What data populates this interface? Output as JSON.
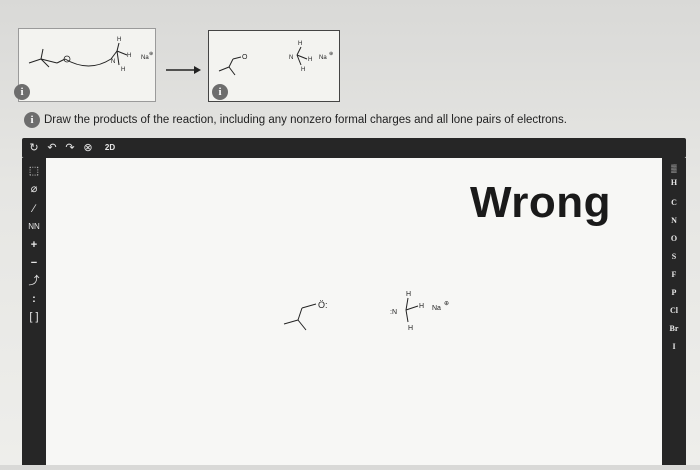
{
  "reaction": {
    "reactant_counterion": "Na",
    "reactant_counterion_charge": "⊕",
    "product_counterion": "Na",
    "product_counterion_charge": "⊕",
    "h_label": "H",
    "n_label": "N",
    "o_label": "O"
  },
  "info_icon_label": "i",
  "instructions": "Draw the products of the reaction, including any nonzero formal charges and all lone pairs of electrons.",
  "feedback": "Wrong",
  "toolbar": {
    "top_icons": [
      "clear-icon",
      "undo-icon",
      "redo-icon",
      "zoom-icon",
      "3d-template-icon"
    ],
    "template_label": "2D"
  },
  "left_tools": [
    "select-tool-icon",
    "eraser-tool-icon",
    "bond-tool-icon",
    "chain-tool-icon",
    "charge-plus-icon",
    "charge-minus-icon",
    "arrow-tool-icon",
    "lone-pair-icon",
    "bracket-tool-icon"
  ],
  "left_tool_labels": {
    "chain": "NN",
    "plus": "+",
    "minus": "−",
    "lone_pair": ":"
  },
  "elements": [
    "H",
    "C",
    "N",
    "O",
    "S",
    "F",
    "P",
    "Cl",
    "Br",
    "I"
  ],
  "canvas_products": {
    "alkoxide_label": "Ö:",
    "amide_n_label": ":N",
    "sodium_label": "Na",
    "sodium_charge": "⊕"
  }
}
